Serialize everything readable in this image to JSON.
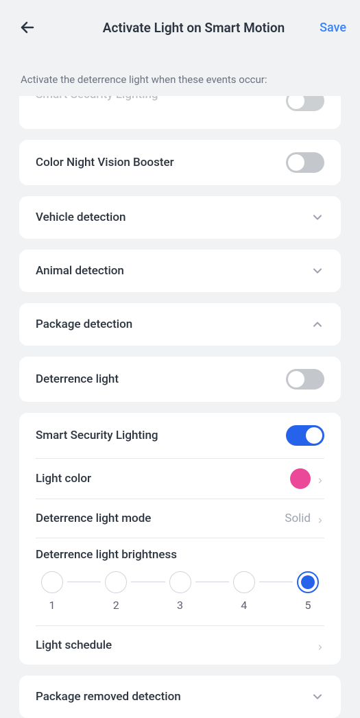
{
  "header": {
    "title": "Activate Light on Smart Motion",
    "save": "Save"
  },
  "subtitle": "Activate the deterrence light when these events occur:",
  "cutoff": {
    "label": "Smart Security Lighting"
  },
  "colorNight": {
    "label": "Color Night Vision Booster",
    "on": false
  },
  "vehicle": {
    "label": "Vehicle detection"
  },
  "animal": {
    "label": "Animal detection"
  },
  "package": {
    "label": "Package detection"
  },
  "deterrence": {
    "label": "Deterrence light",
    "on": false
  },
  "smartSec": {
    "label": "Smart Security Lighting",
    "on": true
  },
  "lightColor": {
    "label": "Light color",
    "colorHex": "#ec4899"
  },
  "lightMode": {
    "label": "Deterrence light mode",
    "value": "Solid"
  },
  "brightness": {
    "label": "Deterrence light brightness",
    "steps": [
      "1",
      "2",
      "3",
      "4",
      "5"
    ],
    "selected": 5
  },
  "schedule": {
    "label": "Light schedule"
  },
  "packageRemoved": {
    "label": "Package removed detection"
  }
}
